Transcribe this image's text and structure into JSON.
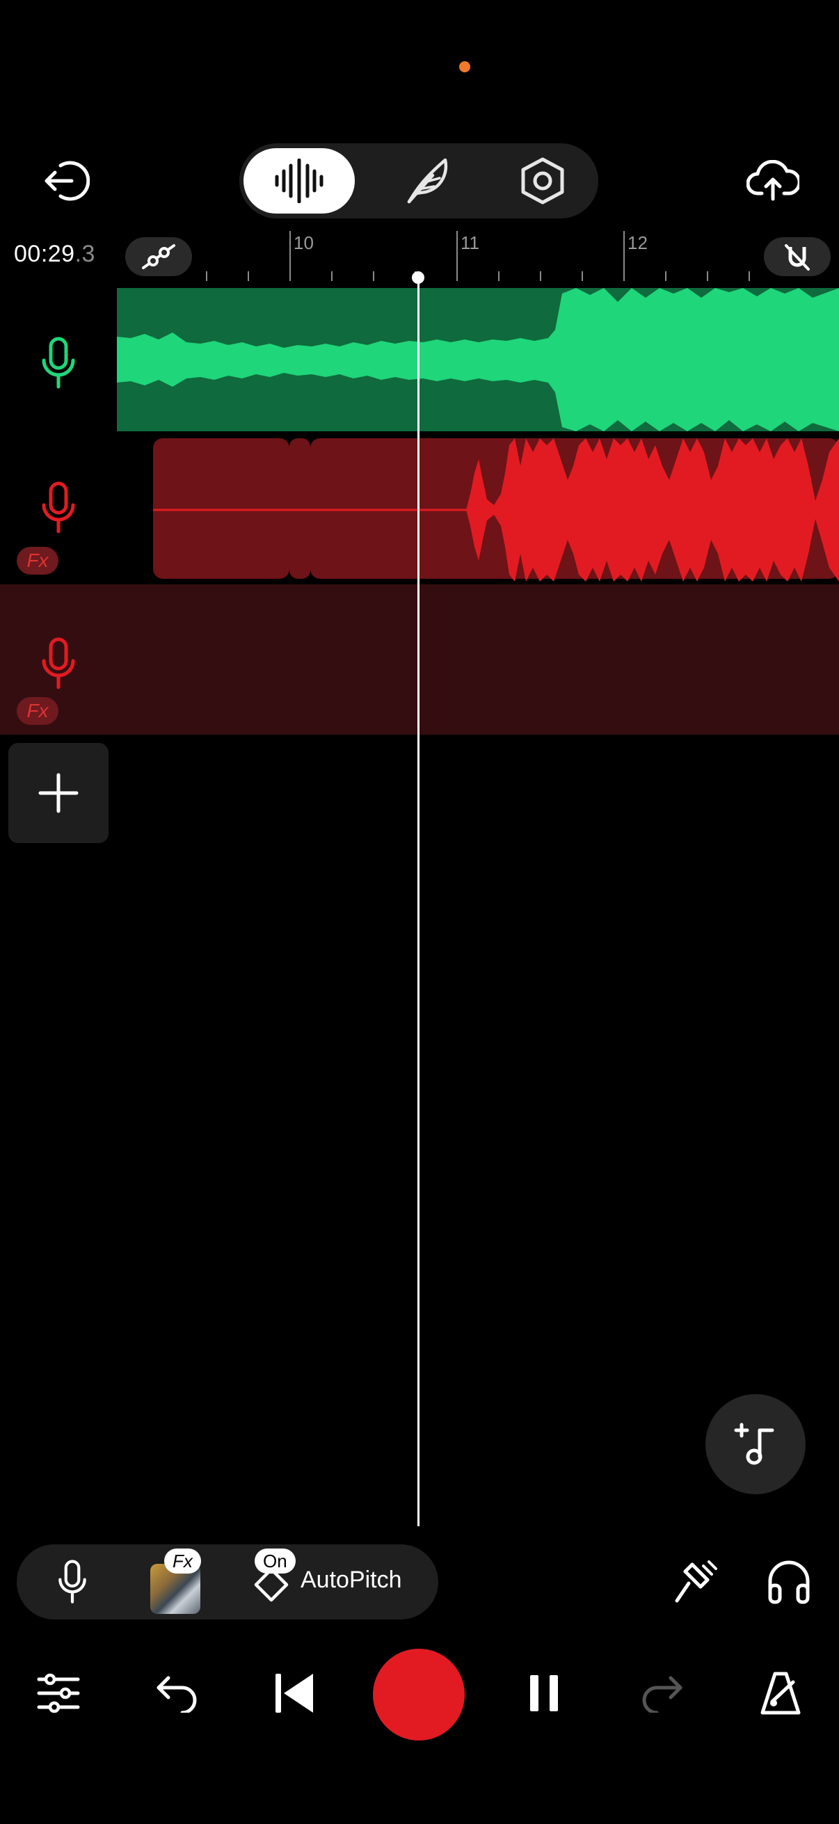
{
  "header": {
    "time": {
      "main": "00:29",
      "fraction": ".3"
    },
    "mode_tabs": [
      {
        "name": "waveform",
        "icon": "waveform-icon",
        "active": true
      },
      {
        "name": "edit",
        "icon": "feather-icon",
        "active": false
      },
      {
        "name": "settings",
        "icon": "hex-settings-icon",
        "active": false
      }
    ],
    "exit_icon": "exit-icon",
    "upload_icon": "cloud-upload-icon"
  },
  "ruler": {
    "bars": [
      "10",
      "11",
      "12"
    ]
  },
  "tracks": [
    {
      "name": "track-1",
      "color": "#1fd67a",
      "fx": false
    },
    {
      "name": "track-2",
      "color": "#e21b22",
      "fx": true,
      "fx_label": "Fx"
    },
    {
      "name": "track-3",
      "color": "#e21b22",
      "fx": true,
      "fx_label": "Fx"
    }
  ],
  "input_bar": {
    "fx_label": "Fx",
    "autopitch_state": "On",
    "autopitch_label": "AutoPitch"
  },
  "colors": {
    "accent_green": "#1fd67a",
    "record_red": "#e21b22",
    "status_dot": "#f07a2a"
  }
}
